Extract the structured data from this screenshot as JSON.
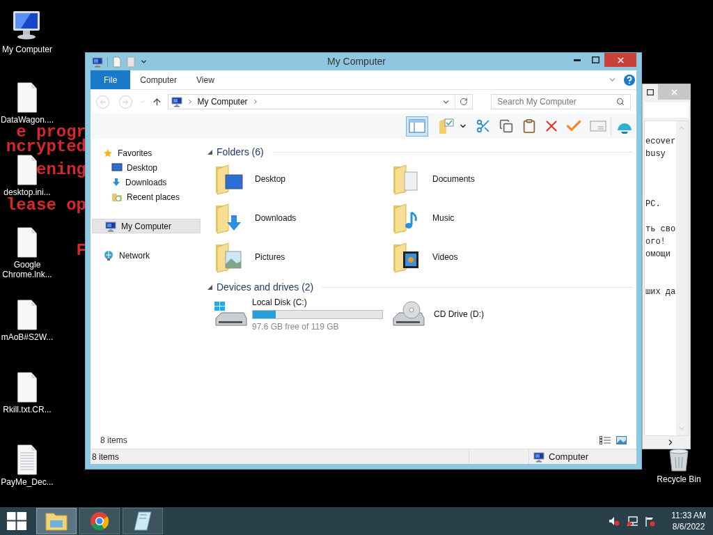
{
  "background_message": {
    "lines": [
      {
        "kind": "text",
        "text": "e progr"
      },
      {
        "kind": "text",
        "text": "ncrypted"
      },
      {
        "kind": "text",
        "text": "ening"
      },
      {
        "kind": "text",
        "text": "lease op"
      },
      {
        "kind": "blank"
      },
      {
        "kind": "text",
        "text": "F"
      }
    ]
  },
  "desktop_icons": [
    {
      "label": "My Computer",
      "kind": "computer"
    },
    {
      "label": "DataWagon....",
      "kind": "file"
    },
    {
      "label": "desktop.ini...",
      "kind": "file"
    },
    {
      "label": "Google Chrome.lnk...",
      "kind": "file"
    },
    {
      "label": "mAoB#S2W...",
      "kind": "file"
    },
    {
      "label": "Rkill.txt.CR...",
      "kind": "file"
    },
    {
      "label": "PayMe_Dec...",
      "kind": "text"
    }
  ],
  "recycle_bin": {
    "label": "Recycle Bin"
  },
  "notepad": {
    "lines": [
      {
        "kind": "text",
        "text": "ecover"
      },
      {
        "kind": "text",
        "text": "busy"
      },
      {
        "kind": "blank"
      },
      {
        "kind": "blank"
      },
      {
        "kind": "blank"
      },
      {
        "kind": "text",
        "text": "PC."
      },
      {
        "kind": "blank"
      },
      {
        "kind": "text",
        "text": "ть сво"
      },
      {
        "kind": "text",
        "text": "ого!"
      },
      {
        "kind": "text",
        "text": "омощи"
      },
      {
        "kind": "blank"
      },
      {
        "kind": "blank"
      },
      {
        "kind": "text",
        "text": "ших да"
      }
    ]
  },
  "explorer": {
    "title": "My Computer",
    "tabs": [
      {
        "label": "File",
        "selected": true
      },
      {
        "label": "Computer",
        "selected": false
      },
      {
        "label": "View",
        "selected": false
      }
    ],
    "address": {
      "path": "My Computer"
    },
    "search": {
      "placeholder": "Search My Computer"
    },
    "nav": [
      {
        "label": "Favorites",
        "kind": "star",
        "selected": false,
        "children": [
          {
            "label": "Desktop",
            "kind": "desktop",
            "selected": false
          },
          {
            "label": "Downloads",
            "kind": "downloads",
            "selected": false
          },
          {
            "label": "Recent places",
            "kind": "recent",
            "selected": false
          }
        ]
      },
      {
        "label": "My Computer",
        "kind": "computer",
        "selected": true
      },
      {
        "label": "Network",
        "kind": "network",
        "selected": false
      }
    ],
    "groups": [
      {
        "title": "Folders (6)",
        "items": [
          {
            "label": "Desktop",
            "kind": "desktop"
          },
          {
            "label": "Documents",
            "kind": "documents"
          },
          {
            "label": "Downloads",
            "kind": "downloads"
          },
          {
            "label": "Music",
            "kind": "music"
          },
          {
            "label": "Pictures",
            "kind": "pictures"
          },
          {
            "label": "Videos",
            "kind": "videos"
          }
        ]
      },
      {
        "title": "Devices and drives (2)",
        "items": [
          {
            "label": "Local Disk (C:)",
            "kind": "disk",
            "level": 0.18,
            "detail": "97.6 GB free of 119 GB"
          },
          {
            "label": "CD Drive (D:)",
            "kind": "cd"
          }
        ]
      }
    ],
    "item_count": "8 items",
    "status_bar": {
      "count": "8 items",
      "location": "Computer"
    }
  },
  "taskbar": {
    "apps": [
      {
        "kind": "explorer",
        "selected": true
      },
      {
        "kind": "chrome",
        "selected": false
      },
      {
        "kind": "notepad",
        "selected": false
      }
    ],
    "time": "11:33 AM",
    "date": "8/6/2022"
  }
}
